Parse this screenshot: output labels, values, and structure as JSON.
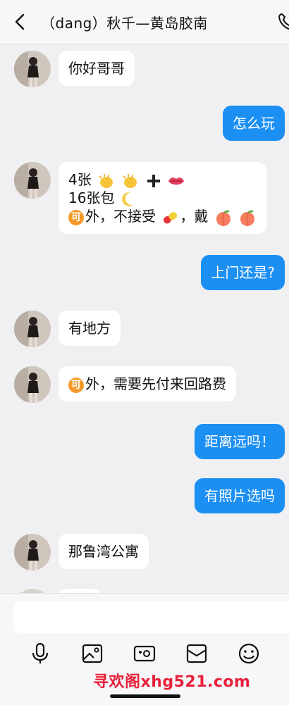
{
  "header": {
    "title": "（dang）秋千—黄岛胶南"
  },
  "messages": [
    {
      "side": "in",
      "text": "你好哥哥"
    },
    {
      "side": "out",
      "text": "怎么玩"
    },
    {
      "side": "in",
      "lines": [
        "4张",
        "16张包",
        "外，不接受",
        "，戴"
      ]
    },
    {
      "side": "out",
      "text": "上门还是?"
    },
    {
      "side": "in",
      "text": "有地方"
    },
    {
      "side": "in",
      "text": "外，需要先付来回路费"
    },
    {
      "side": "out",
      "text": "距离远吗！"
    },
    {
      "side": "out",
      "text": "有照片选吗"
    },
    {
      "side": "in",
      "text": "那鲁湾公寓"
    }
  ],
  "badge": {
    "ke": "可"
  },
  "input": {
    "placeholder": ""
  },
  "toolbar": [
    "microphone-icon",
    "image-icon",
    "video-icon",
    "envelope-icon",
    "emoji-icon"
  ],
  "watermark": "寻欢阁xhg521.com",
  "colors": {
    "accent": "#1c8ff3",
    "bubble_in": "#ffffff",
    "background": "#f0f0f2",
    "watermark": "#e8203a"
  }
}
